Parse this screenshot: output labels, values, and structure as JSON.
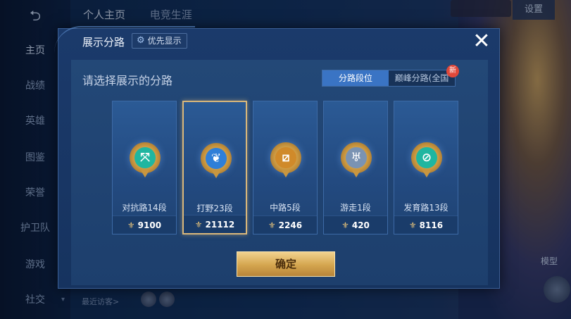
{
  "nav": {
    "back_symbol": "⮌",
    "items": [
      {
        "label": "主页"
      },
      {
        "label": "战绩"
      },
      {
        "label": "英雄"
      },
      {
        "label": "图鉴"
      },
      {
        "label": "荣誉"
      },
      {
        "label": "护卫队"
      },
      {
        "label": "游戏"
      },
      {
        "label": "社交"
      }
    ]
  },
  "top_tabs": {
    "tab1": "个人主页",
    "tab2": "电竞生涯"
  },
  "settings_label": "设置",
  "recent_visitors": "最近访客>",
  "model_label": "模型",
  "modal": {
    "title": "展示分路",
    "priority_label": "优先显示",
    "close_symbol": "✕",
    "prompt": "请选择展示的分路",
    "switch": {
      "option1": "分路段位",
      "option2": "巅峰分路(全国",
      "new_badge": "新"
    },
    "confirm_label": "确定",
    "cards": [
      {
        "label": "对抗路14段",
        "score": "9100",
        "color": "#1fb6a0",
        "icon": "sword-cross-icon",
        "glyph": "⤧"
      },
      {
        "label": "打野23段",
        "score": "21112",
        "color": "#2f7fd8",
        "icon": "dragon-icon",
        "glyph": "❦"
      },
      {
        "label": "中路5段",
        "score": "2246",
        "color": "#d08a2a",
        "icon": "slash-icon",
        "glyph": "⧄"
      },
      {
        "label": "游走1段",
        "score": "420",
        "color": "#7a93b3",
        "icon": "wings-icon",
        "glyph": "♅"
      },
      {
        "label": "发育路13段",
        "score": "8116",
        "color": "#1fb6a0",
        "icon": "circle-arrow-icon",
        "glyph": "⊘"
      }
    ],
    "selected_index": 1
  }
}
